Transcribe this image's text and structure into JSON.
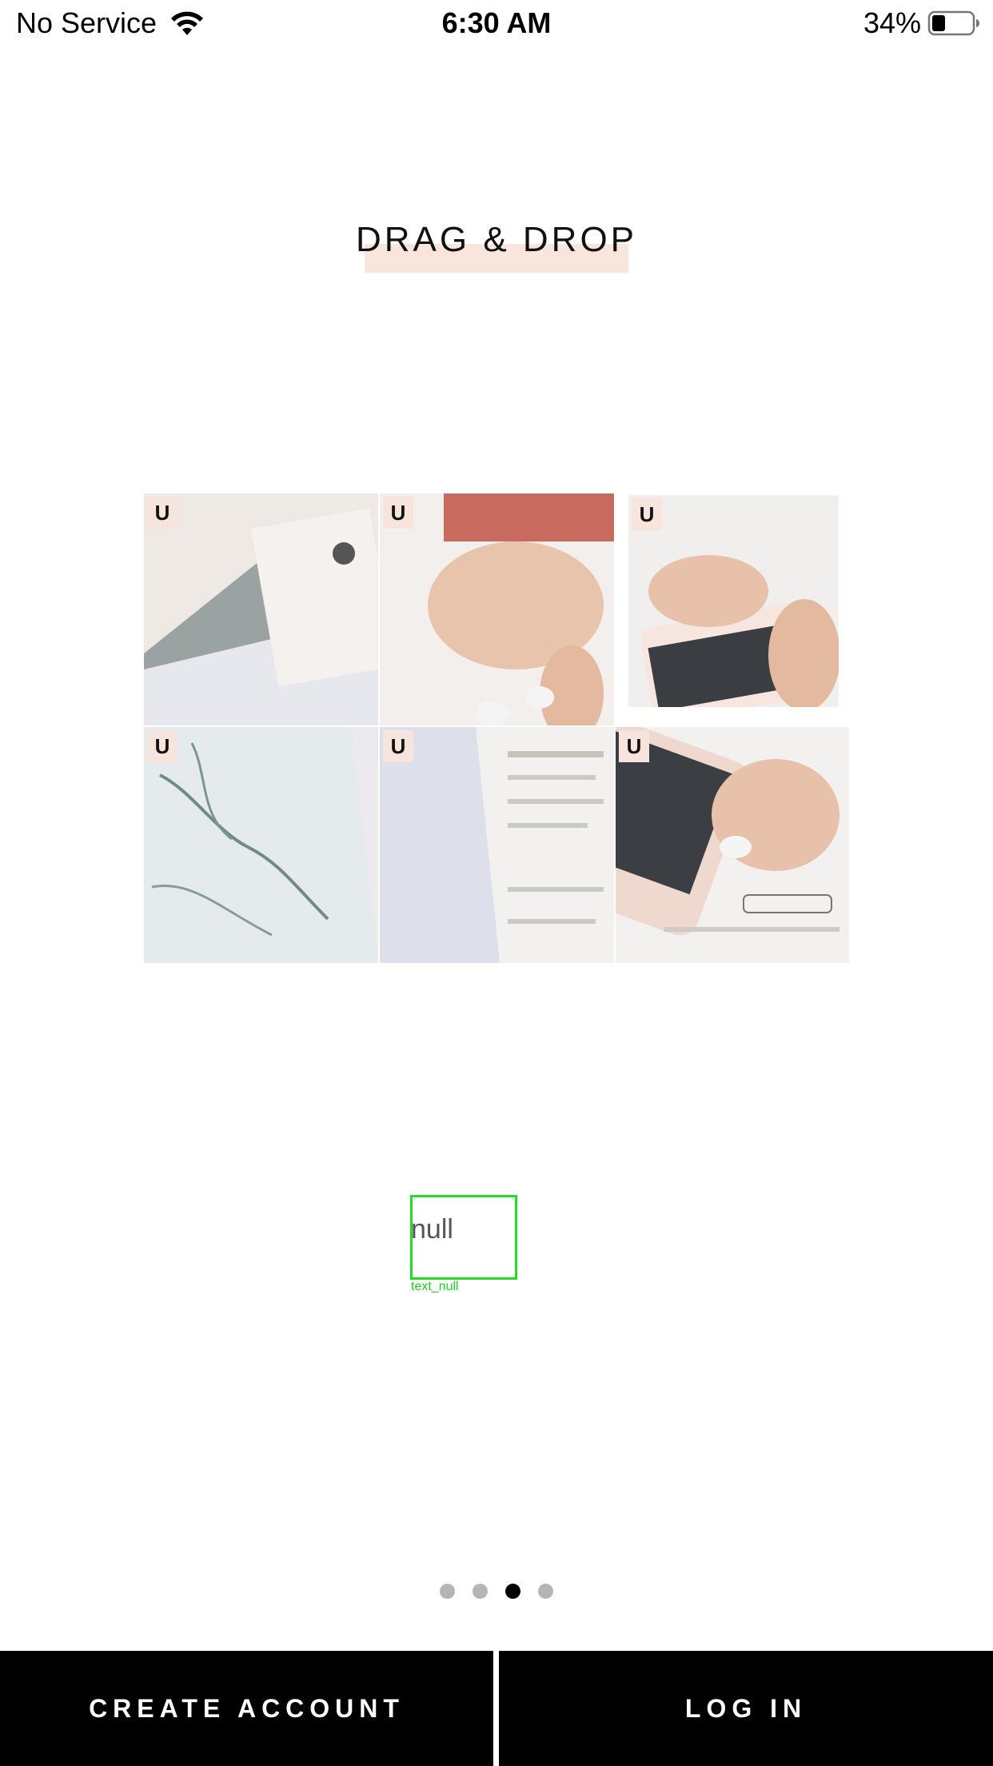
{
  "status_bar": {
    "carrier": "No Service",
    "time": "6:30 AM",
    "battery": "34%",
    "battery_level": 0.34,
    "icons": [
      "wifi-icon",
      "battery-icon"
    ]
  },
  "onboarding": {
    "title": "DRAG & DROP",
    "tile_badge": "U",
    "debug_text": "null",
    "debug_label": "text_null",
    "pages": 4,
    "active_page": 3
  },
  "actions": {
    "create_account": "CREATE ACCOUNT",
    "log_in": "LOG IN"
  },
  "colors": {
    "accent_highlight": "#f8e6dd",
    "button_bg": "#000000",
    "button_text": "#ffffff",
    "debug_outline": "#22dd22"
  }
}
